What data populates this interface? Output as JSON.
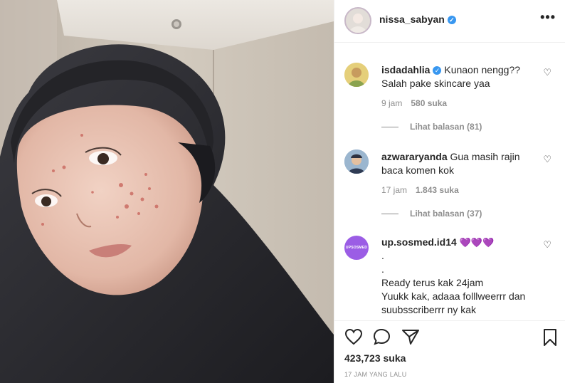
{
  "post": {
    "author": "nissa_sabyan",
    "more_icon": "•••",
    "likes": "423,723 suka",
    "time_ago": "17 JAM YANG LALU"
  },
  "comments": [
    {
      "user": "isdadahlia",
      "verified": true,
      "text": "Kunaon nengg?? Salah pake skincare yaa",
      "time": "9 jam",
      "likes": "580 suka",
      "replies": "Lihat balasan (81)"
    },
    {
      "user": "azwararyanda",
      "verified": false,
      "text": "Gua masih rajin baca komen kok",
      "time": "17 jam",
      "likes": "1.843 suka",
      "replies": "Lihat balasan (37)"
    },
    {
      "user": "up.sosmed.id14",
      "verified": false,
      "emoji": "💜💜💜",
      "lines": [
        ".",
        ".",
        "Ready terus kak 24jam",
        "Yuukk kak, adaaa folllweerrr dan suubsscriberrr ny kak"
      ],
      "avatar_label": "UPSOSMED"
    }
  ],
  "icons": [
    "verified-badge-icon",
    "more-options-icon",
    "heart-icon",
    "comment-icon",
    "share-icon",
    "bookmark-icon"
  ],
  "colors": {
    "verified": "#3897f0",
    "muted": "#8e8e8e",
    "text": "#262626",
    "avatar_purple": "#9b5de5",
    "hijab": "#2a2a2e"
  }
}
